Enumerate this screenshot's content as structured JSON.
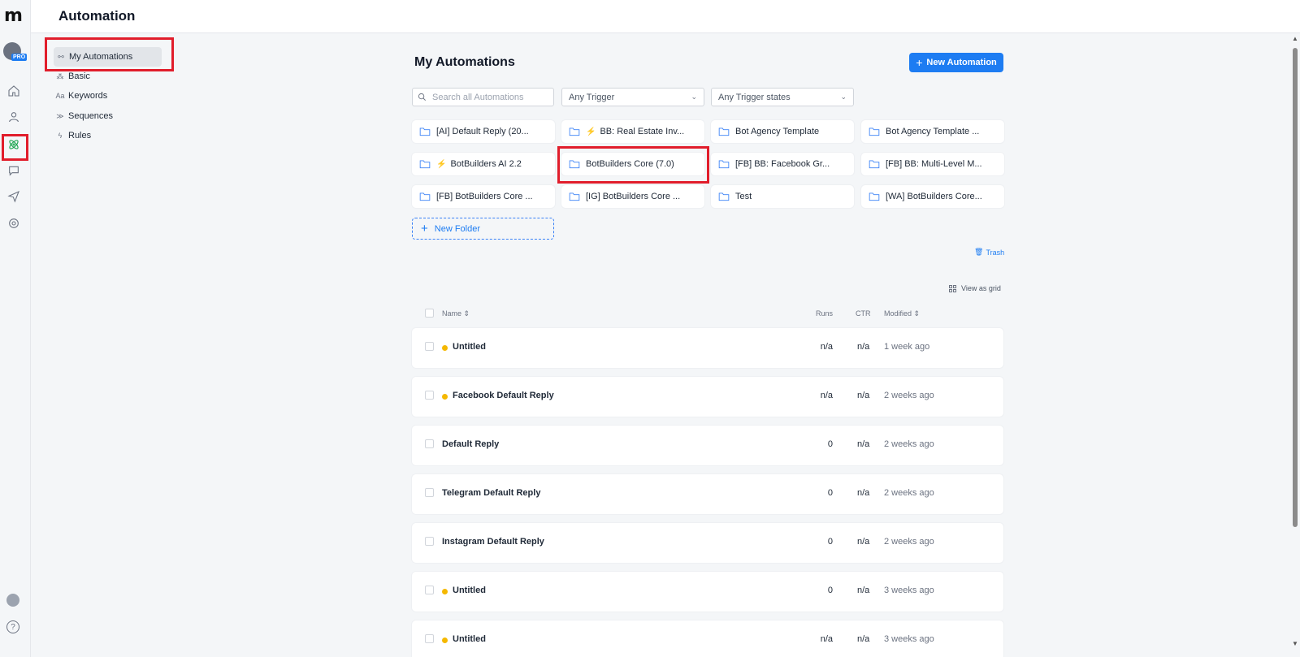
{
  "app": {
    "logo": "m",
    "page_title": "Automation",
    "badge": "PRO"
  },
  "subnav": [
    {
      "label": "My Automations",
      "icon": "⚯"
    },
    {
      "label": "Basic",
      "icon": "⁂"
    },
    {
      "label": "Keywords",
      "icon": "Aa"
    },
    {
      "label": "Sequences",
      "icon": "≫"
    },
    {
      "label": "Rules",
      "icon": "ϟ"
    }
  ],
  "main": {
    "title": "My Automations",
    "new_button": "New Automation",
    "search_placeholder": "Search all Automations",
    "filter_trigger": "Any Trigger",
    "filter_states": "Any Trigger states",
    "new_folder": "New Folder",
    "trash": "Trash",
    "view_as_grid": "View as grid"
  },
  "folders": [
    {
      "name": "[AI] Default Reply (20...",
      "bolt": false
    },
    {
      "name": "BB: Real Estate Inv...",
      "bolt": true
    },
    {
      "name": "Bot Agency Template",
      "bolt": false
    },
    {
      "name": "Bot Agency Template ...",
      "bolt": false
    },
    {
      "name": "BotBuilders AI 2.2",
      "bolt": true
    },
    {
      "name": "BotBuilders Core (7.0)",
      "bolt": false
    },
    {
      "name": "[FB] BB: Facebook Gr...",
      "bolt": false
    },
    {
      "name": "[FB] BB: Multi-Level M...",
      "bolt": false
    },
    {
      "name": "[FB] BotBuilders Core ...",
      "bolt": false
    },
    {
      "name": "[IG] BotBuilders Core ...",
      "bolt": false
    },
    {
      "name": "Test",
      "bolt": false
    },
    {
      "name": "[WA] BotBuilders Core...",
      "bolt": false
    }
  ],
  "table": {
    "headers": {
      "name": "Name",
      "runs": "Runs",
      "ctr": "CTR",
      "modified": "Modified"
    },
    "rows": [
      {
        "name": "Untitled",
        "runs": "n/a",
        "ctr": "n/a",
        "modified": "1 week ago",
        "draft": true
      },
      {
        "name": "Facebook Default Reply",
        "runs": "n/a",
        "ctr": "n/a",
        "modified": "2 weeks ago",
        "draft": true
      },
      {
        "name": "Default Reply",
        "runs": "0",
        "ctr": "n/a",
        "modified": "2 weeks ago",
        "draft": false
      },
      {
        "name": "Telegram Default Reply",
        "runs": "0",
        "ctr": "n/a",
        "modified": "2 weeks ago",
        "draft": false
      },
      {
        "name": "Instagram Default Reply",
        "runs": "0",
        "ctr": "n/a",
        "modified": "2 weeks ago",
        "draft": false
      },
      {
        "name": "Untitled",
        "runs": "0",
        "ctr": "n/a",
        "modified": "3 weeks ago",
        "draft": true
      },
      {
        "name": "Untitled",
        "runs": "n/a",
        "ctr": "n/a",
        "modified": "3 weeks ago",
        "draft": true
      }
    ]
  },
  "colors": {
    "accent": "#1d7cf2",
    "highlight": "#e11d2b",
    "draft_dot": "#f5b800",
    "active_icon": "#16a34a"
  }
}
